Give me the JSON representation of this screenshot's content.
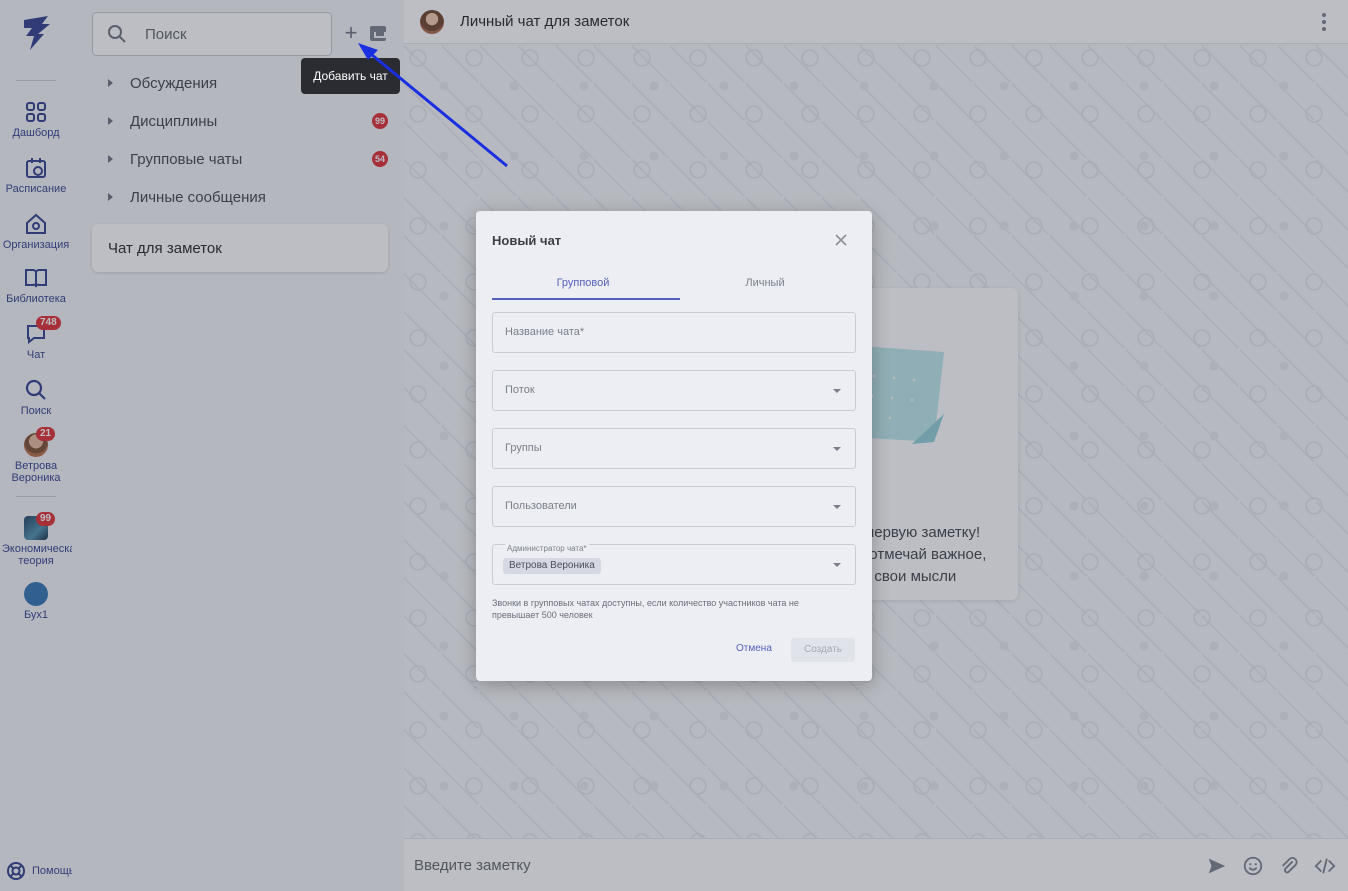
{
  "nav": {
    "items": [
      {
        "label": "Дашборд",
        "icon": "dashboard-icon"
      },
      {
        "label": "Расписание",
        "icon": "calendar-icon"
      },
      {
        "label": "Организация",
        "icon": "home-icon"
      },
      {
        "label": "Библиотека",
        "icon": "book-icon"
      },
      {
        "label": "Чат",
        "icon": "chat-icon",
        "badge": "748"
      },
      {
        "label": "Поиск",
        "icon": "search-icon"
      },
      {
        "label": "Ветрова Вероника",
        "icon": "avatar",
        "badge": "21"
      }
    ],
    "courses": [
      {
        "label": "Экономическая теория",
        "badge": "99"
      },
      {
        "label": "Бух1"
      }
    ],
    "help_label": "Помощь"
  },
  "list": {
    "search_placeholder": "Поиск",
    "add_chat_tooltip": "Добавить чат",
    "folders": [
      {
        "label": "Обсуждения"
      },
      {
        "label": "Дисциплины",
        "badge": "99"
      },
      {
        "label": "Групповые чаты",
        "badge": "54"
      },
      {
        "label": "Личные сообщения"
      }
    ],
    "notes_chat": "Чат для заметок"
  },
  "chat": {
    "title": "Личный чат для заметок",
    "empty_lines": [
      "Создай свою первую заметку!",
      "Конспектируй, отмечай важное,",
      "записывай свои мысли"
    ],
    "input_placeholder": "Введите заметку"
  },
  "dialog": {
    "title": "Новый чат",
    "tabs": [
      "Групповой",
      "Личный"
    ],
    "fields": {
      "name": "Название чата*",
      "stream": "Поток",
      "groups": "Группы",
      "users": "Пользователи",
      "admin_label": "Администратор чата*",
      "admin_value": "Ветрова Вероника"
    },
    "hint": "Звонки в групповых чатах доступны, если количество участников чата не превышает 500 человек",
    "cancel": "Отмена",
    "create": "Создать"
  },
  "colors": {
    "accent": "#5561b8",
    "nav": "#2c3a8c",
    "badge": "#e0262d",
    "annotation_arrow": "#1a2fe0"
  }
}
